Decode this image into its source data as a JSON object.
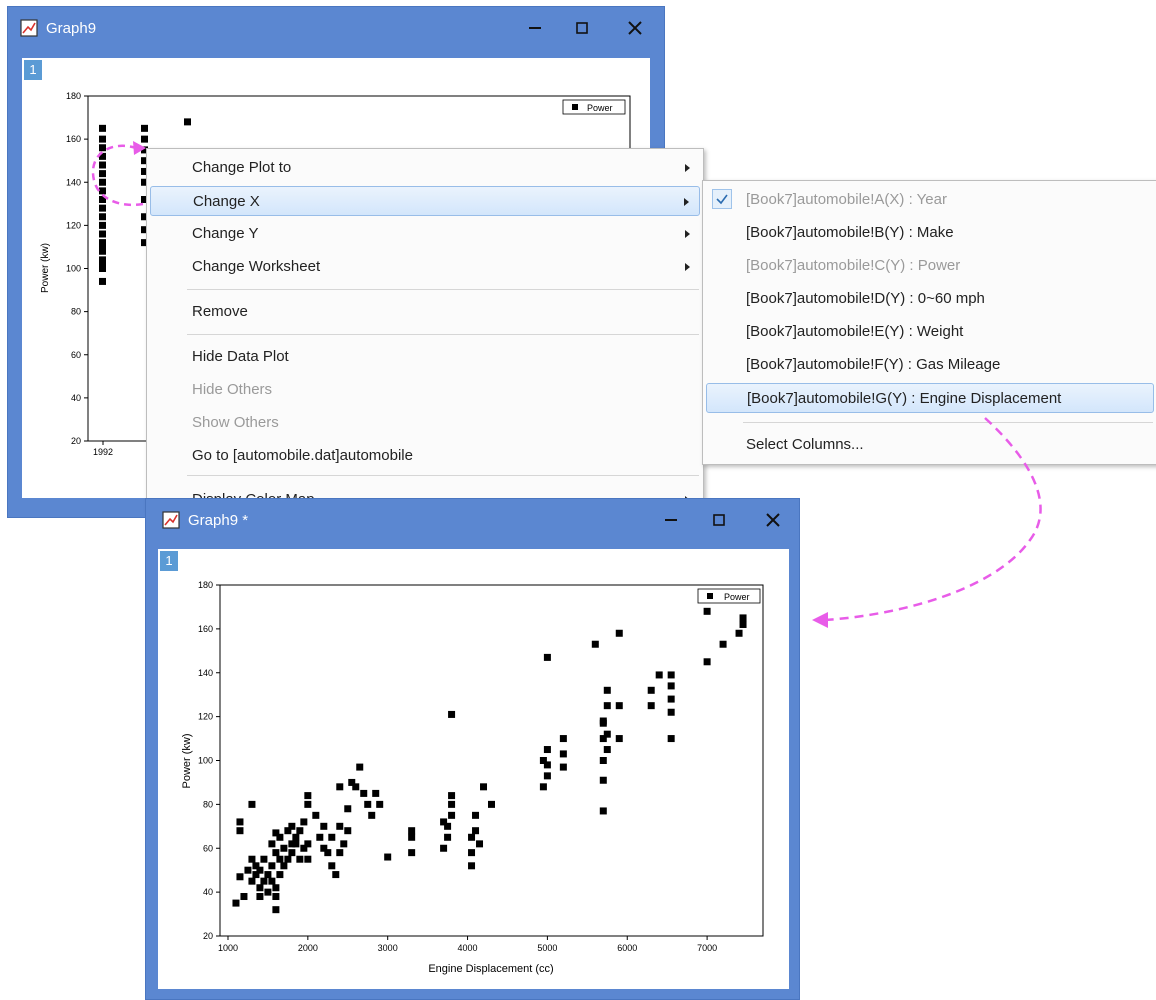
{
  "window1": {
    "title": "Graph9",
    "layer_number": "1",
    "plot": {
      "ylabel": "Power (kw)",
      "y_ticks": [
        "20",
        "40",
        "60",
        "80",
        "100",
        "120",
        "140",
        "160",
        "180"
      ],
      "x_ticks": [
        "1992"
      ],
      "legend": "Power"
    }
  },
  "context_menu": {
    "items": [
      {
        "label": "Change Plot to",
        "submenu": true,
        "disabled": false
      },
      {
        "label": "Change X",
        "submenu": true,
        "disabled": false,
        "highlighted": true
      },
      {
        "label": "Change Y",
        "submenu": true,
        "disabled": false
      },
      {
        "label": "Change Worksheet",
        "submenu": true,
        "disabled": false
      },
      {
        "label": "Remove",
        "submenu": false,
        "disabled": false
      },
      {
        "label": "Hide Data Plot",
        "submenu": false,
        "disabled": false
      },
      {
        "label": "Hide Others",
        "submenu": false,
        "disabled": true
      },
      {
        "label": "Show Others",
        "submenu": false,
        "disabled": true
      },
      {
        "label": "Go to [automobile.dat]automobile",
        "submenu": false,
        "disabled": false
      },
      {
        "label": "Display Color Map...",
        "submenu": true,
        "disabled": false
      }
    ]
  },
  "submenu": {
    "items": [
      {
        "label": "[Book7]automobile!A(X) : Year",
        "checked": true,
        "disabled": true
      },
      {
        "label": "[Book7]automobile!B(Y) : Make",
        "disabled": false
      },
      {
        "label": "[Book7]automobile!C(Y) : Power",
        "disabled": true
      },
      {
        "label": "[Book7]automobile!D(Y) : 0~60 mph",
        "disabled": false
      },
      {
        "label": "[Book7]automobile!E(Y) : Weight",
        "disabled": false
      },
      {
        "label": "[Book7]automobile!F(Y) : Gas Mileage",
        "disabled": false
      },
      {
        "label": "[Book7]automobile!G(Y) : Engine Displacement",
        "disabled": false,
        "highlighted": true
      },
      {
        "label": "Select Columns...",
        "disabled": false
      }
    ]
  },
  "window2": {
    "title": "Graph9 *",
    "layer_number": "1"
  },
  "colors": {
    "window_frame": "#5b87d1",
    "menu_highlight": "#d3e6fb",
    "arrow": "#e85ce8",
    "marker": "#000000"
  },
  "chart_data": [
    {
      "type": "scatter",
      "xlabel": "",
      "ylabel": "Power (kw)",
      "ylim": [
        20,
        180
      ],
      "y_ticks": [
        20,
        40,
        60,
        80,
        100,
        120,
        140,
        160,
        180
      ],
      "x_ticks": [
        "1992"
      ],
      "legend": "Power",
      "series": [
        {
          "name": "Power",
          "x": [
            1992,
            1992,
            1992,
            1992,
            1992,
            1992,
            1992,
            1992,
            1992,
            1992,
            1992,
            1992,
            1992,
            1992,
            1992,
            1992,
            1992,
            1992,
            1992,
            1992
          ],
          "y": [
            94,
            100,
            104,
            108,
            112,
            116,
            120,
            124,
            128,
            132,
            136,
            140,
            144,
            148,
            152,
            156,
            160,
            165,
            102,
            110
          ]
        }
      ]
    },
    {
      "type": "scatter",
      "xlabel": "Engine Displacement (cc)",
      "ylabel": "Power (kw)",
      "xlim": [
        900,
        7700
      ],
      "ylim": [
        20,
        180
      ],
      "x_ticks": [
        1000,
        2000,
        3000,
        4000,
        5000,
        6000,
        7000
      ],
      "y_ticks": [
        20,
        40,
        60,
        80,
        100,
        120,
        140,
        160,
        180
      ],
      "legend": "Power",
      "series": [
        {
          "name": "Power",
          "x": [
            1100,
            1150,
            1150,
            1150,
            1200,
            1250,
            1300,
            1300,
            1300,
            1350,
            1350,
            1400,
            1400,
            1400,
            1450,
            1450,
            1500,
            1500,
            1550,
            1550,
            1550,
            1600,
            1600,
            1600,
            1600,
            1600,
            1650,
            1650,
            1650,
            1700,
            1700,
            1750,
            1750,
            1800,
            1800,
            1800,
            1850,
            1850,
            1900,
            1900,
            1950,
            1950,
            2000,
            2000,
            2000,
            2000,
            2100,
            2150,
            2200,
            2200,
            2250,
            2300,
            2300,
            2350,
            2400,
            2400,
            2400,
            2450,
            2500,
            2500,
            2550,
            2600,
            2650,
            2700,
            2750,
            2800,
            2850,
            2900,
            3000,
            3300,
            3300,
            3300,
            3700,
            3700,
            3750,
            3750,
            3800,
            3800,
            3800,
            3800,
            4050,
            4050,
            4050,
            4100,
            4100,
            4150,
            4200,
            4300,
            4950,
            4950,
            5000,
            5000,
            5000,
            5000,
            5200,
            5200,
            5200,
            5600,
            5700,
            5700,
            5700,
            5700,
            5700,
            5700,
            5750,
            5750,
            5750,
            5750,
            5900,
            5900,
            5900,
            6300,
            6300,
            6400,
            6550,
            6550,
            6550,
            6550,
            6550,
            7000,
            7000,
            7200,
            7400,
            7450,
            7450
          ],
          "y": [
            35,
            47,
            68,
            72,
            38,
            50,
            45,
            55,
            80,
            48,
            52,
            38,
            42,
            50,
            45,
            55,
            40,
            48,
            45,
            52,
            62,
            32,
            38,
            42,
            58,
            67,
            48,
            55,
            65,
            52,
            60,
            55,
            68,
            58,
            62,
            70,
            62,
            65,
            55,
            68,
            60,
            72,
            55,
            62,
            80,
            84,
            75,
            65,
            60,
            70,
            58,
            52,
            65,
            48,
            58,
            70,
            88,
            62,
            68,
            78,
            90,
            88,
            97,
            85,
            80,
            75,
            85,
            80,
            56,
            58,
            65,
            68,
            60,
            72,
            65,
            70,
            80,
            84,
            121,
            75,
            52,
            58,
            65,
            68,
            75,
            62,
            88,
            80,
            88,
            100,
            93,
            98,
            105,
            147,
            97,
            103,
            110,
            153,
            117,
            77,
            91,
            100,
            110,
            118,
            125,
            105,
            112,
            132,
            110,
            125,
            158,
            125,
            132,
            139,
            110,
            122,
            128,
            134,
            139,
            168,
            145,
            153,
            158,
            162,
            165
          ]
        }
      ]
    }
  ]
}
